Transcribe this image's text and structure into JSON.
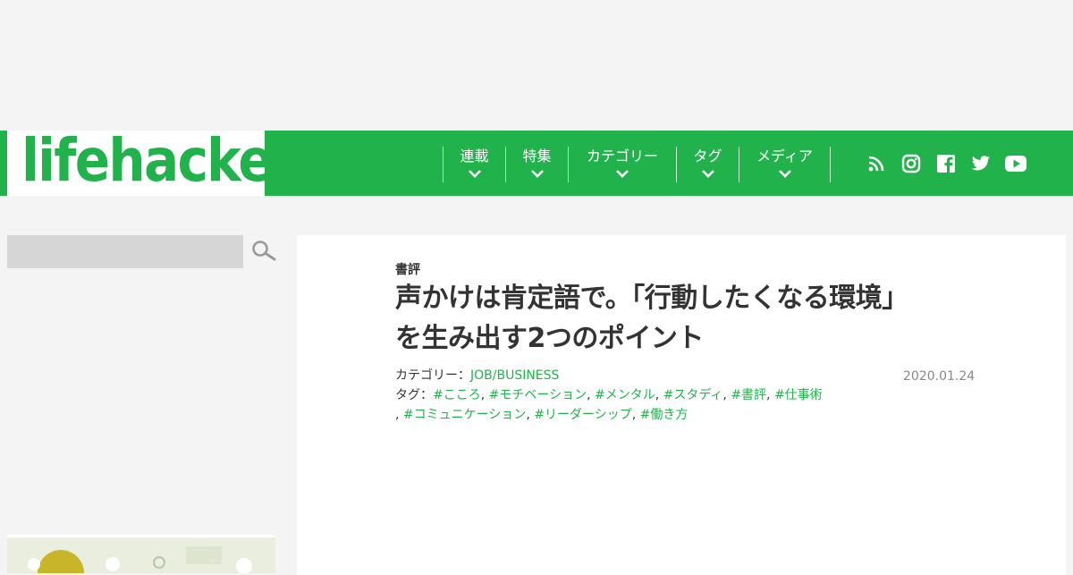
{
  "brand": {
    "logo_text": "lifehacker",
    "color": "#22b24c"
  },
  "nav": [
    {
      "label": "連載"
    },
    {
      "label": "特集"
    },
    {
      "label": "カテゴリー"
    },
    {
      "label": "タグ"
    },
    {
      "label": "メディア"
    }
  ],
  "social_icons": [
    "rss-icon",
    "instagram-icon",
    "facebook-icon",
    "twitter-icon",
    "youtube-icon"
  ],
  "search": {
    "placeholder": ""
  },
  "article": {
    "category": "書評",
    "title_line1": "声かけは肯定語で。「行動したくなる環境」",
    "title_line2": "を生み出す2つのポイント",
    "meta_category_label": "カテゴリー：",
    "meta_category_value": "JOB/BUSINESS",
    "date": "2020.01.24",
    "tags_label": "タグ：",
    "tags_line1": [
      "#こころ",
      "#モチベーション",
      "#メンタル",
      "#スタディ",
      "#書評",
      "#仕事術"
    ],
    "tags_line2": [
      "#コミュニケーション",
      "#リーダーシップ",
      "#働き方"
    ]
  }
}
